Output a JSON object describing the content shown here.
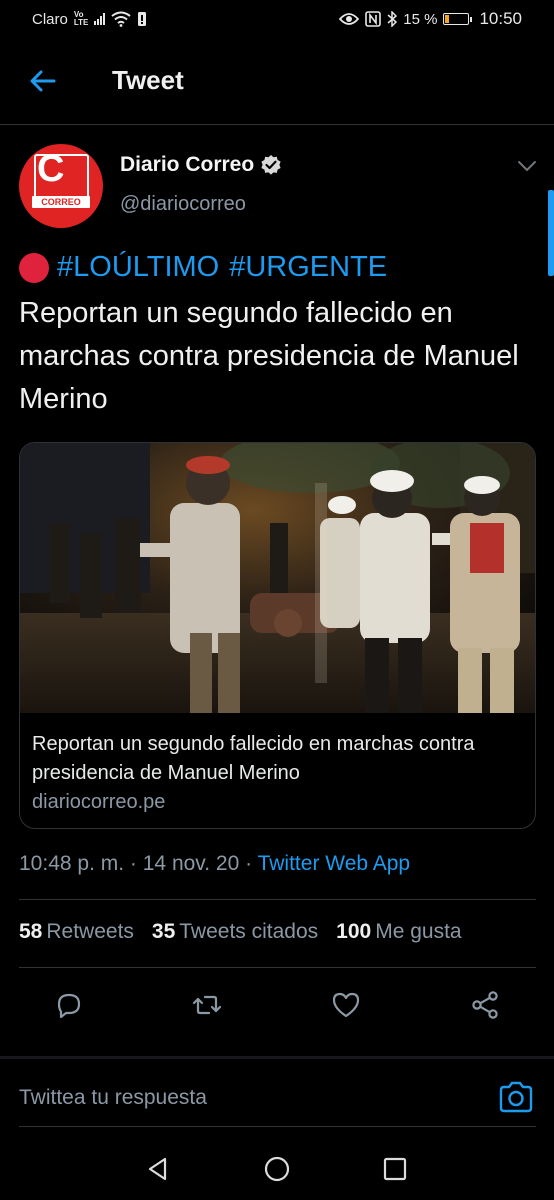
{
  "status_bar": {
    "carrier": "Claro",
    "volte_top": "Vo",
    "volte_bottom": "LTE",
    "battery_percent": "15 %",
    "battery_level": 0.15,
    "time": "10:50"
  },
  "header": {
    "title": "Tweet"
  },
  "tweet": {
    "author_name": "Diario Correo",
    "author_handle": "@diariocorreo",
    "avatar_letter": "C",
    "avatar_word": "CORREO",
    "hashtags": [
      "#LOÚLTIMO",
      "#URGENTE"
    ],
    "text": "Reportan un segundo fallecido en marchas contra presidencia de Manuel Merino",
    "card": {
      "title": "Reportan un segundo fallecido en marchas contra presidencia de Manuel Merino",
      "domain": "diariocorreo.pe"
    },
    "time": "10:48 p. m.",
    "date": "14 nov. 20",
    "separator": "·",
    "source": "Twitter Web App",
    "retweets_count": "58",
    "retweets_label": "Retweets",
    "quotes_count": "35",
    "quotes_label": "Tweets citados",
    "likes_count": "100",
    "likes_label": "Me gusta"
  },
  "reply": {
    "placeholder": "Twittea tu respuesta"
  },
  "colors": {
    "accent": "#1d9bf0",
    "background": "#000000",
    "secondary_text": "#8b98a5",
    "divider": "#2f3336",
    "brand_red": "#e02424"
  },
  "icons": {
    "back": "arrow-left-icon",
    "verified": "verified-badge-icon",
    "more": "chevron-down-icon",
    "reply": "reply-icon",
    "retweet": "retweet-icon",
    "like": "heart-icon",
    "share": "share-icon",
    "camera": "camera-icon",
    "nav_back": "triangle-back-icon",
    "nav_home": "circle-home-icon",
    "nav_recents": "square-recents-icon"
  }
}
